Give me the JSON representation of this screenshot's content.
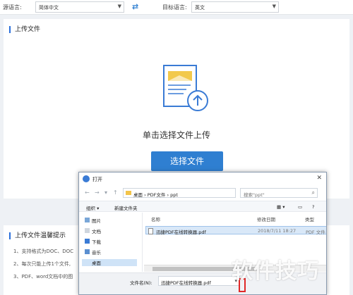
{
  "langbar": {
    "source_label": "源语言:",
    "source_value": "简体中文",
    "target_label": "目标语言:",
    "target_value": "英文"
  },
  "upload": {
    "title": "上传文件",
    "prompt": "单击选择文件上传",
    "button": "选择文件"
  },
  "tips": {
    "title": "上传文件温馨提示",
    "items": [
      "1、支持格式为DOC、DOC",
      "2、每次只能上传1个文件,",
      "3、PDF、word文档中的图"
    ]
  },
  "dialog": {
    "title": "打开",
    "breadcrumb": [
      "桌面",
      "PDF文件",
      "ppt"
    ],
    "search_placeholder": "搜索\"ppt\"",
    "toolbar": {
      "organize": "组织 ▾",
      "new_folder": "新建文件夹"
    },
    "nav_items": [
      "图片",
      "文档",
      "下载",
      "音乐",
      "桌面"
    ],
    "columns": {
      "name": "名称",
      "modified": "修改日期",
      "type": "类型"
    },
    "file": {
      "name": "迅捷PDF在线转换器.pdf",
      "modified": "2018/7/11 18:27",
      "type": "PDF 文件"
    },
    "filename_label": "文件名(N):",
    "filename_value": "迅捷PDF在线转换器.pdf"
  },
  "watermark": "软件技巧",
  "colors": {
    "accent": "#2f7fd1",
    "highlight": "#e02828"
  }
}
